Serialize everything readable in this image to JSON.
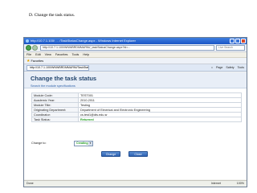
{
  "caption": "D. Change the task status.",
  "browser": {
    "title": "http://10.7.1.100/ … /TaskStatusChange.aspx - Windows Internet Explorer",
    "address": "http://10.7.1.100/WNWBRDMMARNI/_taskStatusChange.aspx?id=...",
    "search_placeholder": "Live Search",
    "menu": [
      "File",
      "Edit",
      "View",
      "Favorites",
      "Tools",
      "Help"
    ],
    "favorites_label": "Favorites",
    "tab_title": "http://10.7.1.100/WNWBRDMMARNI/TaskStatusCha...",
    "commands": [
      "Page",
      "Safety",
      "Tools"
    ],
    "status_left": "Done",
    "status_zone": "Internet",
    "status_zoom": "100%"
  },
  "page": {
    "heading": "Change the task status",
    "link": "Search the module specifications",
    "rows": [
      {
        "label": "Module Code:",
        "value": "TEST001"
      },
      {
        "label": "Academic Year:",
        "value": "2010-2011"
      },
      {
        "label": "Module Title:",
        "value": "Testing"
      },
      {
        "label": "Originating Department:",
        "value": "Department of Electrical and Electronic Engineering"
      },
      {
        "label": "Coordinator:",
        "value": "cs.test1@dts.edu.sr"
      },
      {
        "label": "Task Status:",
        "value": "Returned"
      }
    ],
    "change_to_label": "Change to:",
    "change_to_value": "Creating",
    "change_button": "Change",
    "close_button": "Close"
  }
}
